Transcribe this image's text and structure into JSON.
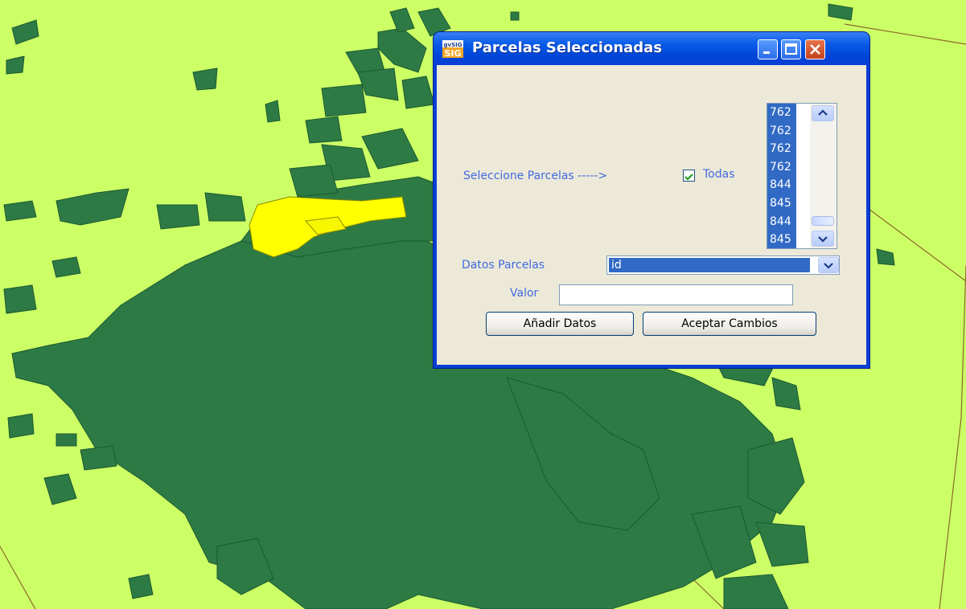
{
  "window": {
    "title": "Parcelas Seleccionadas",
    "app_icon": "gvsig-logo-icon",
    "controls": [
      "minimize-icon",
      "maximize-icon",
      "close-icon"
    ]
  },
  "form": {
    "select_label": "Seleccione Parcelas ----->",
    "all_checkbox": {
      "label": "Todas",
      "checked": true
    },
    "parcel_list": [
      "762",
      "762",
      "762",
      "762",
      "844",
      "845",
      "844",
      "845"
    ],
    "data_label": "Datos Parcelas",
    "data_field": {
      "selected": "id"
    },
    "value_label": "Valor",
    "value_input": "",
    "add_button": "Añadir Datos",
    "accept_button": "Aceptar Cambios"
  },
  "colors": {
    "map_background": "#ccff66",
    "parcels": "#2d7a45",
    "selected_parcels": "#ffff00",
    "window_frame": "#0a3fd6",
    "dialog_body": "#ece9d8",
    "label_text": "#4169e1",
    "selection": "#316ac5"
  }
}
